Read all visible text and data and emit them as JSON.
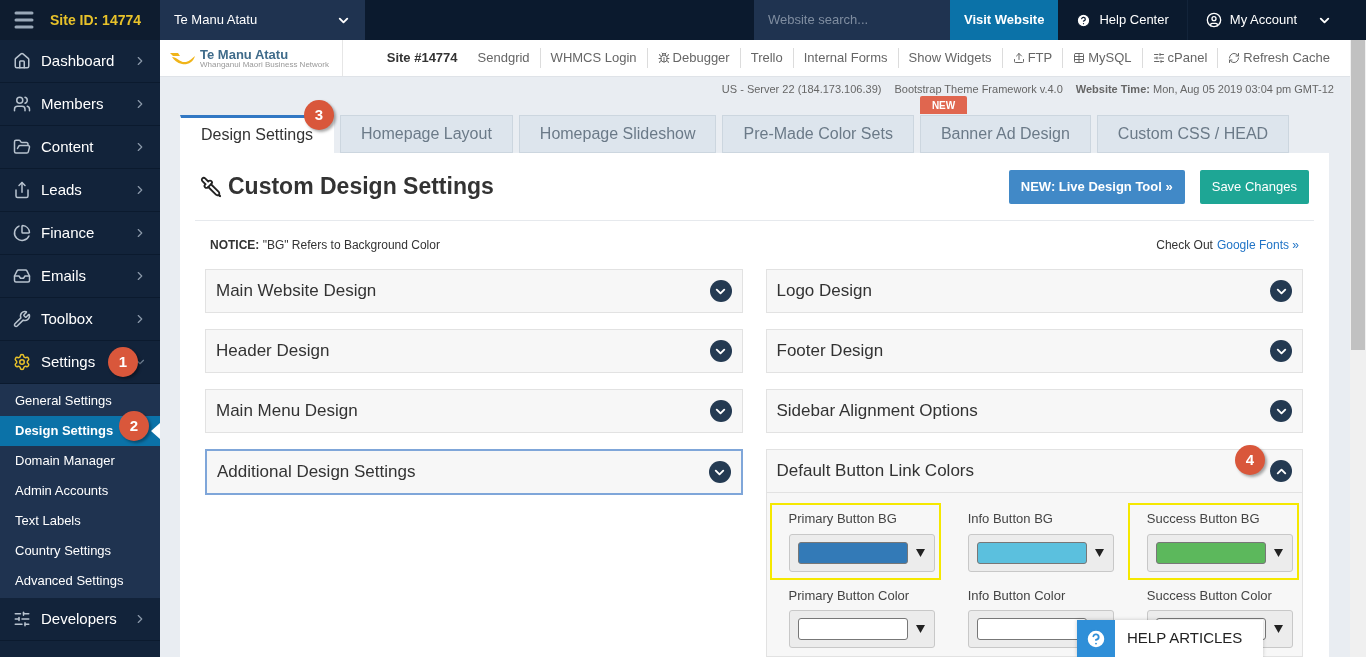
{
  "top_bar": {
    "site_id": "Site ID: 14774",
    "site_selector": "Te Manu Atatu",
    "search": {
      "placeholder": "Website search..."
    },
    "buttons": [
      {
        "kind": "visit",
        "label": "Visit Website"
      },
      {
        "kind": "help",
        "label": "Help Center"
      },
      {
        "kind": "account",
        "label": "My Account"
      }
    ]
  },
  "sidebar": {
    "items": [
      {
        "label": "Dashboard",
        "expanded": false
      },
      {
        "label": "Members",
        "expanded": false
      },
      {
        "label": "Content",
        "expanded": false
      },
      {
        "label": "Leads",
        "expanded": false
      },
      {
        "label": "Finance",
        "expanded": false
      },
      {
        "label": "Emails",
        "expanded": false
      },
      {
        "label": "Toolbox",
        "expanded": false
      },
      {
        "label": "Settings",
        "expanded": true,
        "marker": "1",
        "children": [
          {
            "label": "General Settings",
            "selected": false
          },
          {
            "label": "Design Settings",
            "selected": true,
            "marker": "2"
          },
          {
            "label": "Domain Manager",
            "selected": false
          },
          {
            "label": "Admin Accounts",
            "selected": false
          },
          {
            "label": "Text Labels",
            "selected": false
          },
          {
            "label": "Country Settings",
            "selected": false
          },
          {
            "label": "Advanced Settings",
            "selected": false
          }
        ]
      },
      {
        "label": "Developers",
        "expanded": false
      }
    ]
  },
  "sub_bar": {
    "logo": {
      "name": "Te Manu Atatu",
      "tagline": "Whanganui Maori Business Network"
    },
    "site": "Site #14774",
    "links": [
      {
        "label": "Sendgrid"
      },
      {
        "label": "WHMCS Login"
      },
      {
        "label": "Debugger"
      },
      {
        "label": "Trello"
      },
      {
        "label": "Internal Forms"
      },
      {
        "label": "Show Widgets"
      },
      {
        "label": "FTP"
      },
      {
        "label": "MySQL"
      },
      {
        "label": "cPanel"
      },
      {
        "label": "Refresh Cache"
      }
    ]
  },
  "info_line": {
    "server": "US - Server 22 (184.173.106.39)",
    "framework": "Bootstrap Theme Framework v.4.0",
    "time_label": "Website Time:",
    "time_value": "Mon, Aug 05 2019 03:04 pm GMT-12"
  },
  "tabs": [
    {
      "label": "Design Settings",
      "selected": true,
      "marker": "3"
    },
    {
      "label": "Homepage Layout",
      "selected": false
    },
    {
      "label": "Homepage Slideshow",
      "selected": false
    },
    {
      "label": "Pre-Made Color Sets",
      "selected": false
    },
    {
      "label": "Banner Ad Design",
      "selected": false,
      "badge": "NEW"
    },
    {
      "label": "Custom CSS / HEAD",
      "selected": false
    }
  ],
  "content": {
    "title": "Custom Design Settings",
    "buttons": [
      {
        "kind": "primary",
        "label": "NEW: Live Design Tool »"
      },
      {
        "kind": "success",
        "label": "Save Changes"
      }
    ],
    "notice": "**NOTICE:** \"BG\" Refers to Background Color",
    "fonts_text": "Check Out",
    "fonts_link": "Google Fonts »",
    "left_panels": [
      {
        "title": "Main Website Design",
        "expanded": false,
        "highlighted": false
      },
      {
        "title": "Header Design",
        "expanded": false,
        "highlighted": false
      },
      {
        "title": "Main Menu Design",
        "expanded": false,
        "highlighted": false
      },
      {
        "title": "Additional Design Settings",
        "expanded": false,
        "highlighted": true
      }
    ],
    "right_panels": [
      {
        "title": "Logo Design",
        "expanded": false,
        "highlighted": false
      },
      {
        "title": "Footer Design",
        "expanded": false,
        "highlighted": false
      },
      {
        "title": "Sidebar Alignment Options",
        "expanded": false,
        "highlighted": false
      },
      {
        "title": "Default Button Link Colors",
        "expanded": true,
        "highlighted": false,
        "marker": "4",
        "fields": [
          {
            "label": "Primary Button BG",
            "color": "#337ab7",
            "highlighted": true
          },
          {
            "label": "Info Button BG",
            "color": "#5bc0de",
            "highlighted": false
          },
          {
            "label": "Success Button BG",
            "color": "#5cb85c",
            "highlighted": true
          },
          {
            "label": "Primary Button Color",
            "color": "#ffffff",
            "highlighted": false
          },
          {
            "label": "Info Button Color",
            "color": "#ffffff",
            "highlighted": false
          },
          {
            "label": "Success Button Color",
            "color": "#ffffff",
            "highlighted": false
          }
        ]
      }
    ]
  },
  "help_widget": {
    "label": "HELP ARTICLES"
  }
}
